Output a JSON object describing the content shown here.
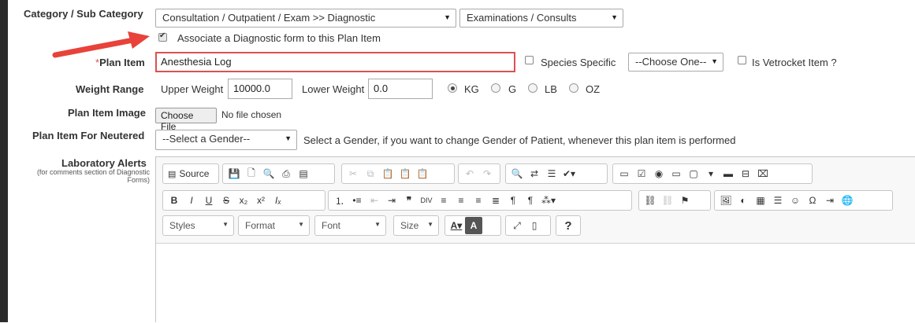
{
  "form": {
    "category_label": "Category / Sub Category",
    "category_value": "Consultation / Outpatient / Exam >> Diagnostic",
    "subcategory_value": "Examinations / Consults",
    "diag_checkbox_label": "Associate a Diagnostic form to this Plan Item",
    "plan_item_label": "Plan Item",
    "plan_item_required": "*",
    "plan_item_value": "Anesthesia Log",
    "species_label": "Species Specific",
    "species_select": "--Choose One--",
    "vetrocket_label": "Is Vetrocket Item ?",
    "weight_label": "Weight Range",
    "upper_label": "Upper Weight",
    "upper_value": "10000.0",
    "lower_label": "Lower Weight",
    "lower_value": "0.0",
    "units": [
      "KG",
      "G",
      "LB",
      "OZ"
    ],
    "selected_unit": "KG",
    "image_label": "Plan Item Image",
    "choose_file": "Choose File",
    "no_file": "No file chosen",
    "neutered_label": "Plan Item For Neutered",
    "gender_select": "--Select a Gender--",
    "gender_hint": "Select a Gender, if you want to change Gender of Patient, whenever this plan item is performed",
    "lab_label": "Laboratory Alerts",
    "lab_sub": "(for comments section of Diagnostic Forms)"
  },
  "editor": {
    "source_label": "Source",
    "styles": "Styles",
    "format": "Format",
    "font": "Font",
    "size": "Size",
    "help": "?"
  },
  "colors": {
    "arrow": "#e8423a",
    "required": "#d9534f",
    "invalid_border": "#d9534f"
  }
}
